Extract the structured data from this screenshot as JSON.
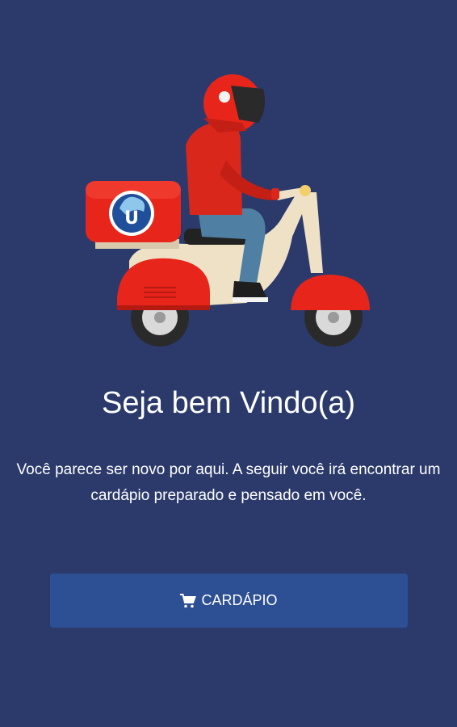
{
  "welcome": {
    "title": "Seja bem Vindo(a)",
    "subtitle": "Você parece ser novo por aqui. A seguir você irá encontrar um cardápio preparado e pensado em você."
  },
  "menu_button": {
    "label": "CARDÁPIO",
    "icon": "cart-icon"
  },
  "illustration": {
    "name": "scooter-delivery-illustration",
    "box_letter": "U"
  },
  "colors": {
    "background": "#2b3a6b",
    "button": "#2d4f94",
    "accent": "#e8251a"
  }
}
